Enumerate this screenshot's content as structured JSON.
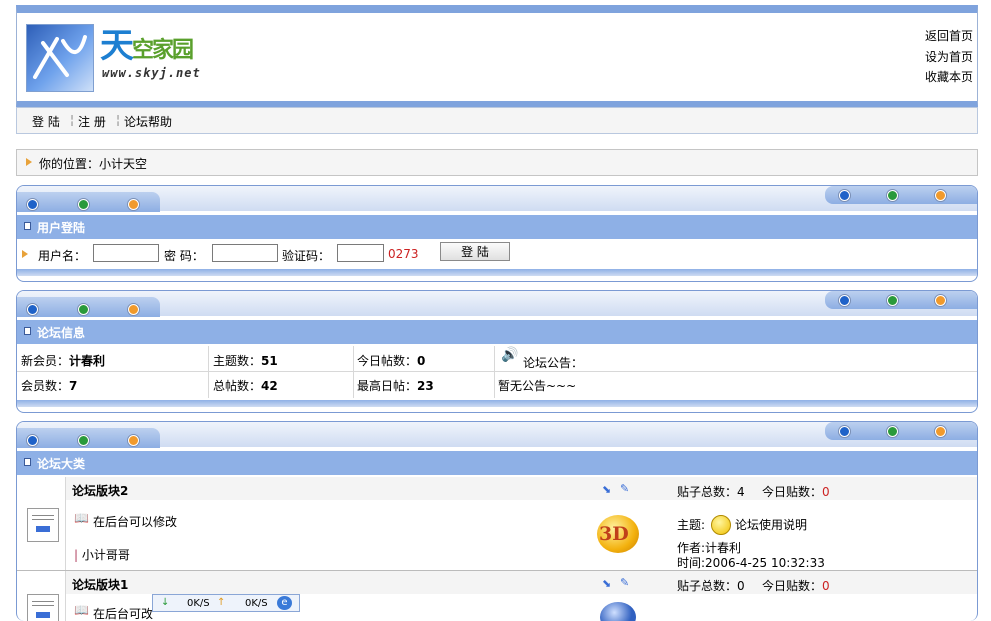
{
  "header": {
    "logo_cn": "天空家园",
    "logo_url": "www.skyj.net",
    "links": [
      "返回首页",
      "设为首页",
      "收藏本页"
    ]
  },
  "nav": {
    "login": "登 陆",
    "register": "注 册",
    "help": "论坛帮助"
  },
  "location": {
    "label": "你的位置：小计天空"
  },
  "login_panel": {
    "title": "用户登陆",
    "username_label": "用户名：",
    "password_label": "密 码：",
    "captcha_label": "验证码：",
    "captcha_code": "0273",
    "submit": "登 陆"
  },
  "info_panel": {
    "title": "论坛信息",
    "new_member_label": "新会员：",
    "new_member": "计春利",
    "topics_label": "主题数：",
    "topics": "51",
    "today_posts_label": "今日帖数：",
    "today_posts": "0",
    "announce_label": "论坛公告：",
    "members_label": "会员数：",
    "members": "7",
    "total_posts_label": "总帖数：",
    "total_posts": "42",
    "max_day_label": "最高日帖：",
    "max_day": "23",
    "announce_text": "暂无公告~~~"
  },
  "category_panel": {
    "title": "论坛大类",
    "forums": [
      {
        "name": "论坛版块2",
        "desc": "在后台可以修改",
        "moderator": "小计哥哥",
        "posts_label": "贴子总数：",
        "posts": "4",
        "today_label": "今日贴数：",
        "today": "0",
        "topic_label": "主题:",
        "topic": "论坛使用说明",
        "author": "作者:计春利",
        "time": "时间:2006-4-25 10:32:33"
      },
      {
        "name": "论坛版块1",
        "desc": "在后台可改",
        "posts_label": "贴子总数：",
        "posts": "0",
        "today_label": "今日贴数：",
        "today": "0"
      }
    ]
  },
  "tray": {
    "down": "0K/S",
    "up": "0K/S"
  },
  "colors": {
    "accent": "#8eb0e6",
    "dot_blue": "#1f62c8",
    "dot_green": "#2a9a3a",
    "dot_orange": "#f19a2c",
    "red": "#cc2222"
  }
}
